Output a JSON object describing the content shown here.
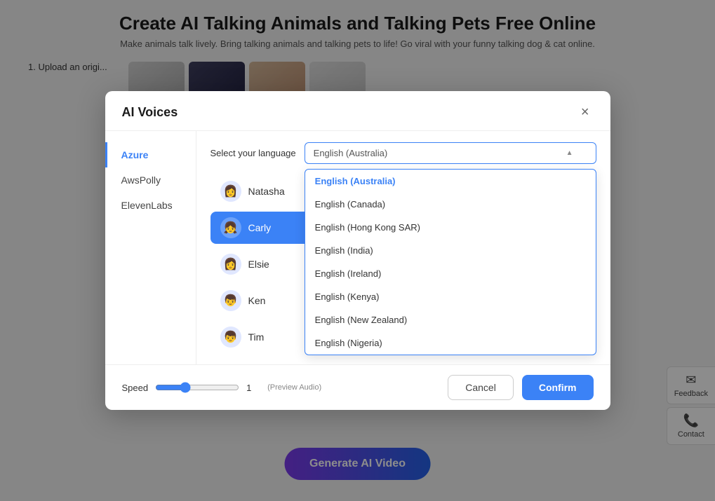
{
  "page": {
    "title": "Create AI Talking Animals and Talking Pets Free Online",
    "subtitle": "Make animals talk lively. Bring talking animals and talking pets to life! Go viral with your funny talking dog & cat online."
  },
  "modal": {
    "title": "AI Voices",
    "close_label": "×",
    "sidebar_tabs": [
      {
        "id": "azure",
        "label": "Azure",
        "active": true
      },
      {
        "id": "awspolly",
        "label": "AwsPolly",
        "active": false
      },
      {
        "id": "elevenlabs",
        "label": "ElevenLabs",
        "active": false
      }
    ],
    "language_label": "Select your language",
    "language_selected": "English (Australia)",
    "language_options": [
      {
        "id": "en-au",
        "label": "English (Australia)",
        "active": true
      },
      {
        "id": "en-ca",
        "label": "English (Canada)",
        "active": false
      },
      {
        "id": "en-hk",
        "label": "English (Hong Kong SAR)",
        "active": false
      },
      {
        "id": "en-in",
        "label": "English (India)",
        "active": false
      },
      {
        "id": "en-ie",
        "label": "English (Ireland)",
        "active": false
      },
      {
        "id": "en-ke",
        "label": "English (Kenya)",
        "active": false
      },
      {
        "id": "en-nz",
        "label": "English (New Zealand)",
        "active": false
      },
      {
        "id": "en-ng",
        "label": "English (Nigeria)",
        "active": false
      }
    ],
    "voices": [
      {
        "id": "natasha",
        "name": "Natasha",
        "emoji": "👩",
        "selected": false
      },
      {
        "id": "carly",
        "name": "Carly",
        "emoji": "👧",
        "selected": true
      },
      {
        "id": "elsie",
        "name": "Elsie",
        "emoji": "👩",
        "selected": false
      },
      {
        "id": "ken",
        "name": "Ken",
        "emoji": "👦",
        "selected": false
      },
      {
        "id": "tim",
        "name": "Tim",
        "emoji": "👦",
        "selected": false
      }
    ],
    "speed_label": "Speed",
    "speed_preview_label": "(Preview Audio)",
    "speed_value": "1",
    "cancel_label": "Cancel",
    "confirm_label": "Confirm"
  },
  "feedback": {
    "label": "Feedback",
    "icon": "✉"
  },
  "contact": {
    "label": "Contact",
    "icon": "📞"
  },
  "generate_btn": "Generate AI Video",
  "bg_steps": {
    "step1": "1.  Upload an origi..."
  }
}
